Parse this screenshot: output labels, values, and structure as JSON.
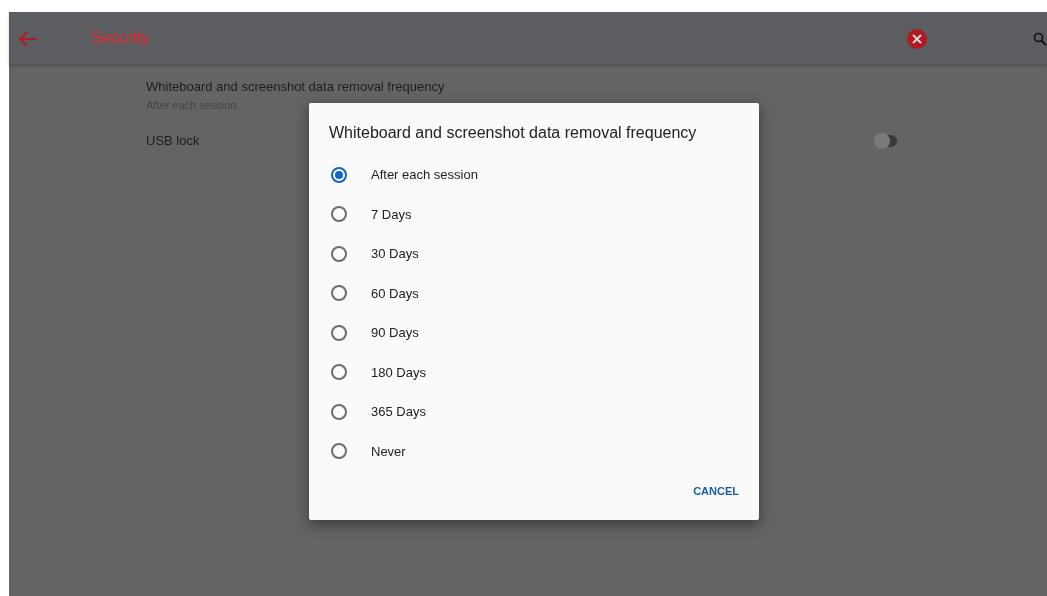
{
  "header": {
    "title": "Security"
  },
  "settings": [
    {
      "kind": "info",
      "label": "Whiteboard and screenshot data removal frequency",
      "summary": "After each session"
    },
    {
      "kind": "toggle",
      "label": "USB lock",
      "on": false
    }
  ],
  "dialog": {
    "title": "Whiteboard and screenshot data removal frequency",
    "options": [
      {
        "label": "After each session",
        "selected": true
      },
      {
        "label": "7 Days",
        "selected": false
      },
      {
        "label": "30 Days",
        "selected": false
      },
      {
        "label": "60 Days",
        "selected": false
      },
      {
        "label": "90 Days",
        "selected": false
      },
      {
        "label": "180 Days",
        "selected": false
      },
      {
        "label": "365 Days",
        "selected": false
      },
      {
        "label": "Never",
        "selected": false
      }
    ],
    "cancel": "CANCEL"
  }
}
